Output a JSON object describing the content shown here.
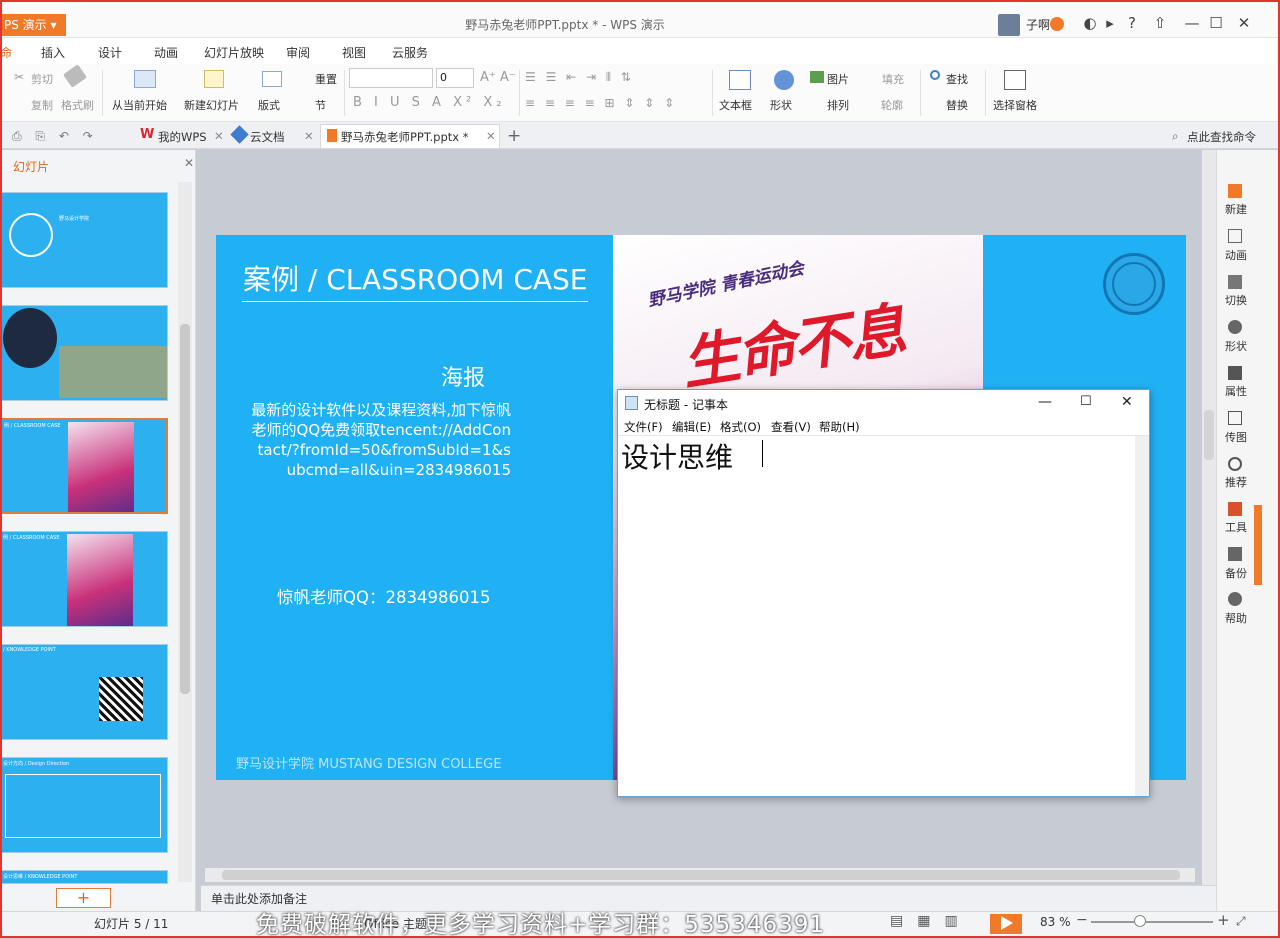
{
  "app": {
    "app_button": "PS 演示",
    "doc_title": "野马赤兔老师PPT.pptx * - WPS 演示",
    "user_name": "子啊",
    "menu_tabs": [
      "插入",
      "设计",
      "动画",
      "幻灯片放映",
      "审阅",
      "视图",
      "云服务"
    ],
    "menu_first_partial": "命"
  },
  "ribbon": {
    "cut": "剪切",
    "copy": "复制",
    "format_painter": "格式刷",
    "play_from_current": "从当前开始",
    "new_slide": "新建幻灯片",
    "layout": "版式",
    "section": "节",
    "reset": "重置",
    "font_size": "0",
    "text_box": "文本框",
    "shape": "形状",
    "picture": "图片",
    "fill": "填充",
    "arrange": "排列",
    "outline": "轮廓",
    "find": "查找",
    "replace": "替换",
    "select_pane": "选择窗格"
  },
  "doc_tabs": {
    "my_wps": "我的WPS",
    "cloud_docs": "云文档",
    "active_file": "野马赤兔老师PPT.pptx *",
    "find_command": "点此查找命令"
  },
  "left_panel": {
    "title": "幻灯片",
    "thumb_texts": [
      "野马设计学院",
      "CLASSROOM CASE",
      "例 / CLASSROOM CASE",
      "/ KNOWLEDGE POINT",
      "设计方向 / Design Direction",
      "设计思维 / KNOWLEDGE POINT"
    ],
    "add_button": "+"
  },
  "slide": {
    "title": "案例 / CLASSROOM CASE",
    "subtitle": "海报",
    "body": "最新的设计软件以及课程资料,加下惊帆老师的QQ免费领取tencent://AddContact/?fromId=50&fromSubId=1&subcmd=all&uin=2834986015",
    "qq": "惊帆老师QQ：2834986015",
    "footer": "野马设计学院    MUSTANG DESIGN COLLEGE",
    "poster_logo": "野马学院 青春运动会",
    "poster_headline": "生命不息"
  },
  "notepad": {
    "title": "无标题 - 记事本",
    "menus": [
      "文件(F)",
      "编辑(E)",
      "格式(O)",
      "查看(V)",
      "帮助(H)"
    ],
    "content": "设计思维"
  },
  "right_panel": {
    "items": [
      "新建",
      "动画",
      "切换",
      "形状",
      "属性",
      "传图",
      "推荐",
      "工具",
      "备份",
      "帮助"
    ]
  },
  "notes": {
    "placeholder": "单击此处添加备注"
  },
  "status": {
    "slide_counter": "幻灯片 5 / 11",
    "theme": "Office 主题",
    "zoom": "83 %",
    "watermark": "免费破解软件，更多学习资料+学习群：535346391"
  },
  "colors": {
    "accent": "#f07a2a",
    "slide_blue": "#20b1f4",
    "poster_red": "#e0192a"
  }
}
